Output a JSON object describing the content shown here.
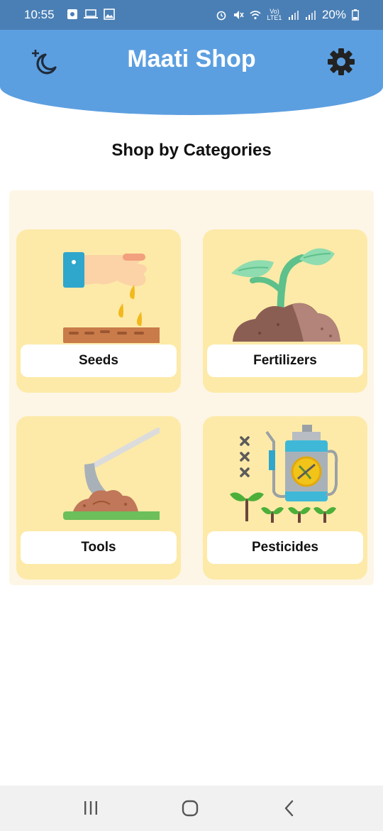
{
  "status_bar": {
    "time": "10:55",
    "battery": "20%",
    "network_label": "Vo) LTE1"
  },
  "header": {
    "title": "Maati Shop",
    "theme_toggle_icon": "moon-icon",
    "settings_icon": "gear-icon",
    "background_color": "#5c9fe0"
  },
  "section": {
    "title": "Shop by Categories"
  },
  "categories": [
    {
      "label": "Seeds",
      "icon": "seeds-illustration"
    },
    {
      "label": "Fertilizers",
      "icon": "plant-illustration"
    },
    {
      "label": "Tools",
      "icon": "hoe-illustration"
    },
    {
      "label": "Pesticides",
      "icon": "sprayer-illustration"
    }
  ],
  "colors": {
    "panel": "#fdf6e7",
    "card": "#fdeaa8",
    "status_bar": "#4a7fb5"
  },
  "nav_bar": {
    "recents_icon": "recents-icon",
    "home_icon": "home-icon",
    "back_icon": "back-icon"
  }
}
